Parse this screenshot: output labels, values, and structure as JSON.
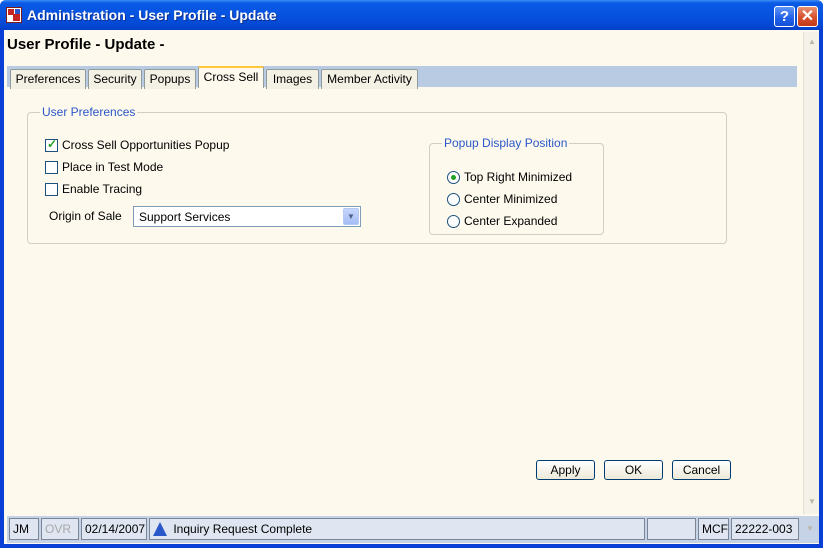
{
  "window": {
    "title": "Administration - User Profile - Update",
    "help_glyph": "?",
    "close_glyph": "✕"
  },
  "page": {
    "heading": "User Profile - Update -"
  },
  "tabs": [
    {
      "label": "Preferences",
      "active": false
    },
    {
      "label": "Security",
      "active": false
    },
    {
      "label": "Popups",
      "active": false
    },
    {
      "label": "Cross Sell",
      "active": true
    },
    {
      "label": "Images",
      "active": false
    },
    {
      "label": "Member Activity",
      "active": false
    }
  ],
  "user_preferences": {
    "legend": "User Preferences",
    "checkboxes": [
      {
        "label": "Cross Sell Opportunities Popup",
        "checked": true
      },
      {
        "label": "Place in Test Mode",
        "checked": false
      },
      {
        "label": "Enable Tracing",
        "checked": false
      }
    ],
    "origin_of_sale": {
      "label": "Origin of Sale",
      "value": "Support Services"
    }
  },
  "popup_position": {
    "legend": "Popup Display Position",
    "options": [
      {
        "label": "Top Right Minimized",
        "selected": true
      },
      {
        "label": "Center Minimized",
        "selected": false
      },
      {
        "label": "Center Expanded",
        "selected": false
      }
    ]
  },
  "buttons": {
    "apply": "Apply",
    "ok": "OK",
    "cancel": "Cancel"
  },
  "statusbar": {
    "user": "JM",
    "mode": "OVR",
    "date": "02/14/2007",
    "message": "Inquiry Request Complete",
    "empty": "",
    "code": "MCF",
    "account": "22222-003"
  },
  "icons": {
    "app": "administration-app-icon",
    "help": "help-icon",
    "close": "close-icon",
    "status": "status-alert-icon",
    "check": "checkmark-icon",
    "dropdown": "chevron-down-icon"
  },
  "colors": {
    "titlebar": "#0653e0",
    "client_background": "#fdf9ed",
    "group_legend": "#2b58c8",
    "check_accent": "#21a121",
    "active_tab_highlight": "#ffc83c",
    "tab_strip": "#b8cbe2"
  }
}
